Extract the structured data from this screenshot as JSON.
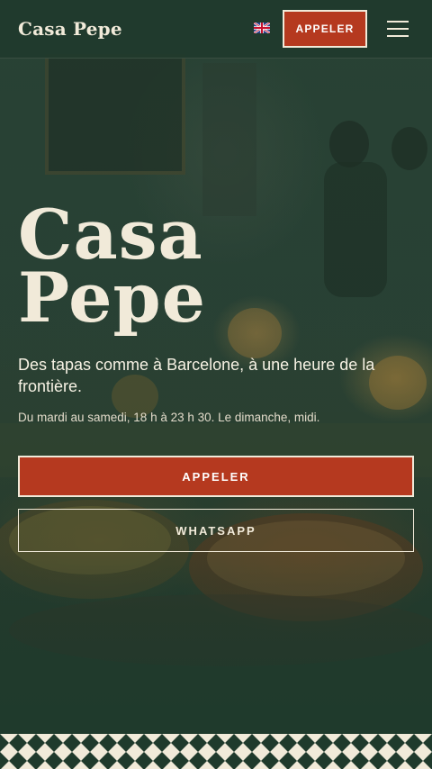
{
  "header": {
    "brand": "Casa Pepe",
    "language_icon": "uk-flag-icon",
    "call_label": "APPELER",
    "menu_icon": "hamburger-menu-icon"
  },
  "hero": {
    "title_line1": "Casa",
    "title_line2": "Pepe",
    "tagline": "Des tapas comme à Barcelone, à une heure de la frontière.",
    "hours": "Du mardi au samedi, 18 h à 23 h 30. Le dimanche, midi.",
    "call_button": "APPELER",
    "whatsapp_button": "WHATSAPP"
  },
  "colors": {
    "brand_green": "#1f3a2c",
    "accent_red": "#b5391f",
    "cream": "#f1ead9"
  }
}
